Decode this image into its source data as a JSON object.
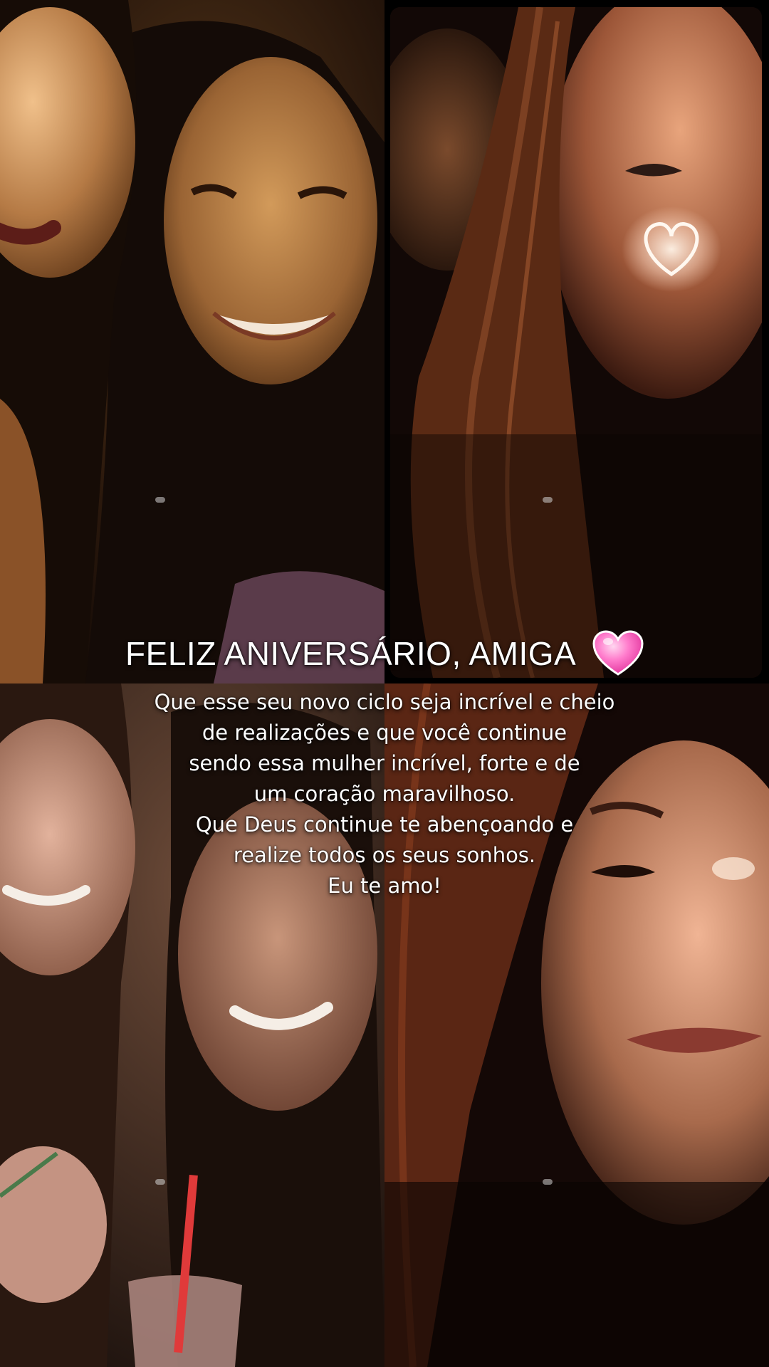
{
  "headline": "FELIZ ANIVERSÁRIO, AMIGA",
  "heart_emoji": "pink-heart",
  "message_lines": [
    "Que esse seu novo ciclo seja incrível e cheio",
    "de realizações e que você continue",
    "sendo essa mulher incrível, forte e de",
    "um coração maravilhoso.",
    "Que Deus continue te abençoando e",
    "realize todos os seus sonhos.",
    "Eu te amo!"
  ],
  "colors": {
    "text": "#ffffff",
    "heart": "#ff5fbf",
    "background": "#000000"
  }
}
